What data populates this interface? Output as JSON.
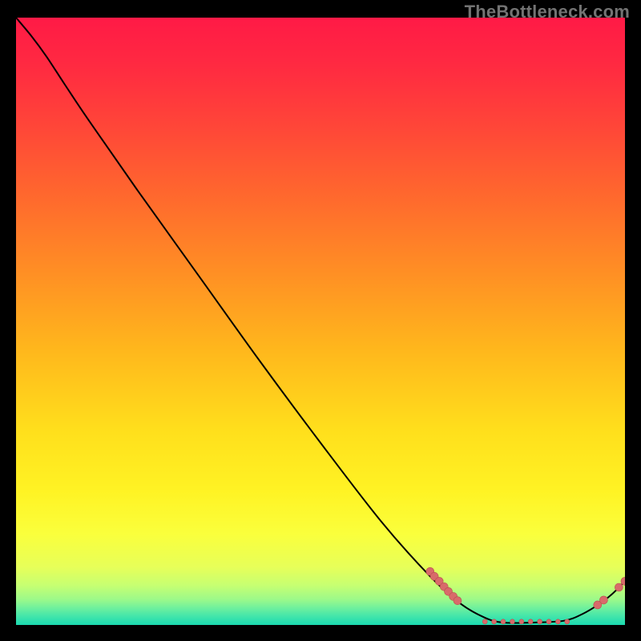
{
  "watermark": "TheBottleneck.com",
  "colors": {
    "point_fill": "#d86a6a",
    "point_stroke": "#bb4f4f",
    "curve": "#000000",
    "gradient_stops": [
      {
        "offset": 0.0,
        "color": "#ff1a46"
      },
      {
        "offset": 0.08,
        "color": "#ff2a41"
      },
      {
        "offset": 0.18,
        "color": "#ff4638"
      },
      {
        "offset": 0.3,
        "color": "#ff6a2d"
      },
      {
        "offset": 0.42,
        "color": "#ff8f24"
      },
      {
        "offset": 0.55,
        "color": "#ffb81c"
      },
      {
        "offset": 0.68,
        "color": "#ffdf1c"
      },
      {
        "offset": 0.78,
        "color": "#fff324"
      },
      {
        "offset": 0.85,
        "color": "#faff3c"
      },
      {
        "offset": 0.905,
        "color": "#e7ff59"
      },
      {
        "offset": 0.935,
        "color": "#c6ff72"
      },
      {
        "offset": 0.958,
        "color": "#9cf98a"
      },
      {
        "offset": 0.972,
        "color": "#6ff09d"
      },
      {
        "offset": 0.985,
        "color": "#45e6aa"
      },
      {
        "offset": 1.0,
        "color": "#1ad9b0"
      }
    ]
  },
  "chart_data": {
    "type": "line",
    "title": "",
    "xlabel": "",
    "ylabel": "",
    "xlim": [
      0,
      100
    ],
    "ylim": [
      0,
      100
    ],
    "grid": false,
    "legend": false,
    "curve_points": [
      {
        "x": 0.0,
        "y": 100.0
      },
      {
        "x": 2.5,
        "y": 97.0
      },
      {
        "x": 5.0,
        "y": 93.6
      },
      {
        "x": 8.0,
        "y": 89.0
      },
      {
        "x": 12.0,
        "y": 83.0
      },
      {
        "x": 20.0,
        "y": 71.5
      },
      {
        "x": 30.0,
        "y": 57.5
      },
      {
        "x": 40.0,
        "y": 43.5
      },
      {
        "x": 50.0,
        "y": 30.0
      },
      {
        "x": 60.0,
        "y": 17.0
      },
      {
        "x": 68.0,
        "y": 8.0
      },
      {
        "x": 73.0,
        "y": 3.5
      },
      {
        "x": 77.0,
        "y": 1.2
      },
      {
        "x": 80.0,
        "y": 0.4
      },
      {
        "x": 85.0,
        "y": 0.4
      },
      {
        "x": 90.0,
        "y": 0.7
      },
      {
        "x": 93.0,
        "y": 1.8
      },
      {
        "x": 96.0,
        "y": 3.6
      },
      {
        "x": 98.0,
        "y": 5.2
      },
      {
        "x": 100.0,
        "y": 7.2
      }
    ],
    "scatter_points": [
      {
        "x": 68.0,
        "y": 8.8,
        "r": 5
      },
      {
        "x": 68.7,
        "y": 8.0,
        "r": 5
      },
      {
        "x": 69.5,
        "y": 7.2,
        "r": 5
      },
      {
        "x": 70.3,
        "y": 6.3,
        "r": 5
      },
      {
        "x": 71.0,
        "y": 5.5,
        "r": 5
      },
      {
        "x": 71.8,
        "y": 4.7,
        "r": 5
      },
      {
        "x": 72.5,
        "y": 4.0,
        "r": 5
      },
      {
        "x": 77.0,
        "y": 0.55,
        "r": 3
      },
      {
        "x": 78.5,
        "y": 0.55,
        "r": 3
      },
      {
        "x": 80.0,
        "y": 0.55,
        "r": 3
      },
      {
        "x": 81.5,
        "y": 0.55,
        "r": 3
      },
      {
        "x": 83.0,
        "y": 0.55,
        "r": 3
      },
      {
        "x": 84.5,
        "y": 0.55,
        "r": 3
      },
      {
        "x": 86.0,
        "y": 0.55,
        "r": 3
      },
      {
        "x": 87.5,
        "y": 0.55,
        "r": 3
      },
      {
        "x": 89.0,
        "y": 0.55,
        "r": 3
      },
      {
        "x": 90.5,
        "y": 0.55,
        "r": 3
      },
      {
        "x": 95.5,
        "y": 3.3,
        "r": 5
      },
      {
        "x": 96.5,
        "y": 4.1,
        "r": 5
      },
      {
        "x": 99.0,
        "y": 6.2,
        "r": 5
      },
      {
        "x": 100.0,
        "y": 7.2,
        "r": 5
      }
    ]
  }
}
